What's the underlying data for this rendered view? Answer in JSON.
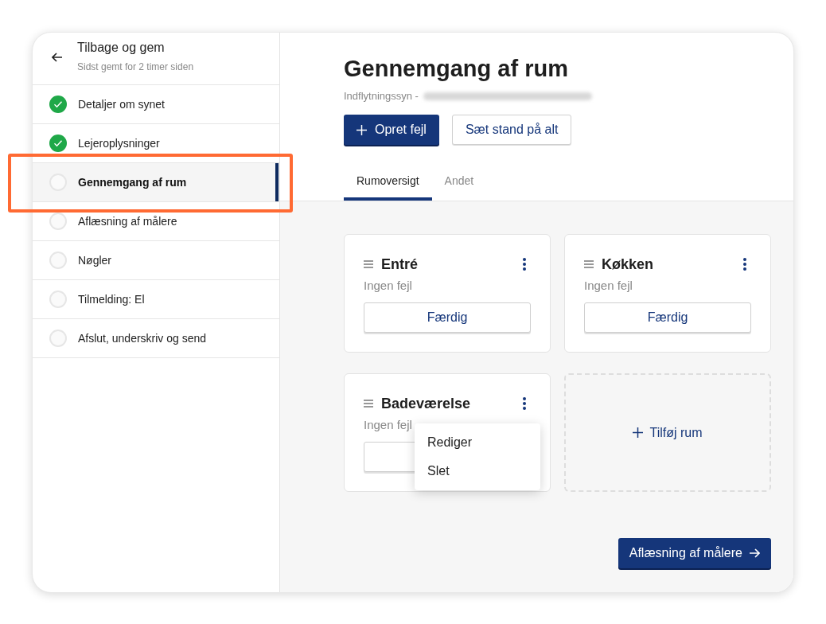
{
  "back": {
    "title": "Tilbage og gem",
    "subtitle": "Sidst gemt for 2 timer siden"
  },
  "steps": [
    {
      "label": "Detaljer om synet",
      "done": true,
      "selected": false
    },
    {
      "label": "Lejeroplysninger",
      "done": true,
      "selected": false
    },
    {
      "label": "Gennemgang af rum",
      "done": false,
      "selected": true
    },
    {
      "label": "Aflæsning af målere",
      "done": false,
      "selected": false
    },
    {
      "label": "Nøgler",
      "done": false,
      "selected": false
    },
    {
      "label": "Tilmelding: El",
      "done": false,
      "selected": false
    },
    {
      "label": "Afslut, underskriv og send",
      "done": false,
      "selected": false
    }
  ],
  "header": {
    "title": "Gennemgang af rum",
    "subtitle": "Indflytningssyn -"
  },
  "actions": [
    {
      "label": "Opret fejl",
      "kind": "primary"
    },
    {
      "label": "Sæt stand på alt",
      "kind": "secondary"
    }
  ],
  "tabs": [
    {
      "label": "Rumoversigt",
      "selected": true
    },
    {
      "label": "Andet",
      "selected": false
    }
  ],
  "rooms": [
    {
      "name": "Entré",
      "status": "Ingen fejl",
      "button": "Færdig"
    },
    {
      "name": "Køkken",
      "status": "Ingen fejl",
      "button": "Færdig"
    },
    {
      "name": "Badeværelse",
      "status": "Ingen fejl",
      "menu": [
        "Rediger",
        "Slet"
      ]
    }
  ],
  "add_room": "Tilføj rum",
  "next_button": "Aflæsning af målere"
}
